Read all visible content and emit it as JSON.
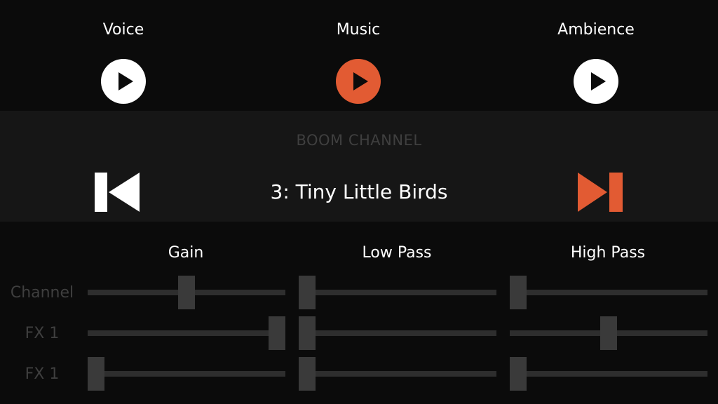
{
  "colors": {
    "accent": "#e25b33",
    "inactive_button": "#ffffff",
    "muted_text": "#3f3f3f",
    "background": "#0b0b0b",
    "channel_band": "#161616"
  },
  "categories": [
    {
      "label": "Voice",
      "active": false
    },
    {
      "label": "Music",
      "active": true
    },
    {
      "label": "Ambience",
      "active": false
    }
  ],
  "channel": {
    "title": "BOOM CHANNEL",
    "track": "3: Tiny Little Birds",
    "prev_icon": "skip-previous-icon",
    "next_icon": "skip-next-icon"
  },
  "mixer": {
    "columns": [
      "Gain",
      "Low Pass",
      "High Pass"
    ],
    "rows": [
      {
        "label": "Channel",
        "levels": [
          0.5,
          0.0,
          0.0
        ]
      },
      {
        "label": "FX 1",
        "levels": [
          1.0,
          0.0,
          0.5
        ]
      },
      {
        "label": "FX 1",
        "levels": [
          0.0,
          0.0,
          0.0
        ]
      }
    ]
  }
}
